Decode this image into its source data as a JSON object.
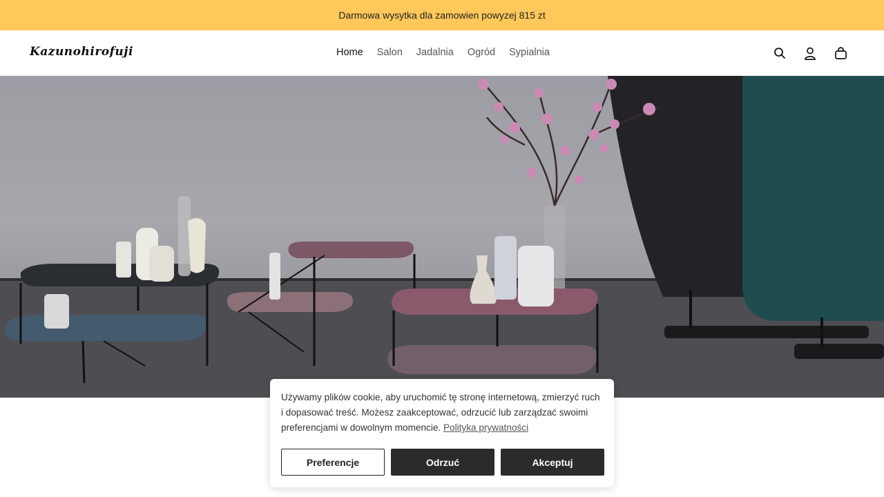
{
  "announcement": {
    "text": "Darmowa wysytka dla zamowien powyzej 815 zt"
  },
  "header": {
    "logo": "Kazunohirofuji",
    "nav": [
      {
        "label": "Home",
        "active": true
      },
      {
        "label": "Salon",
        "active": false
      },
      {
        "label": "Jadalnia",
        "active": false
      },
      {
        "label": "Ogród",
        "active": false
      },
      {
        "label": "Sypialnia",
        "active": false
      }
    ],
    "icons": [
      "search-icon",
      "account-icon",
      "cart-icon"
    ]
  },
  "cookie_banner": {
    "text": "Używamy plików cookie, aby uruchomić tę stronę internetową, zmierzyć ruch i dopasować treść. Możesz zaakceptować, odrzucić lub zarządzać swoimi preferencjami w dowolnym momencie.",
    "link": "Polityka prywatności",
    "buttons": {
      "preferences": "Preferencje",
      "reject": "Odrzuć",
      "accept": "Akceptuj"
    }
  },
  "colors": {
    "announcement_bg": "#ffc85a",
    "button_dark": "#2b2b2b"
  }
}
